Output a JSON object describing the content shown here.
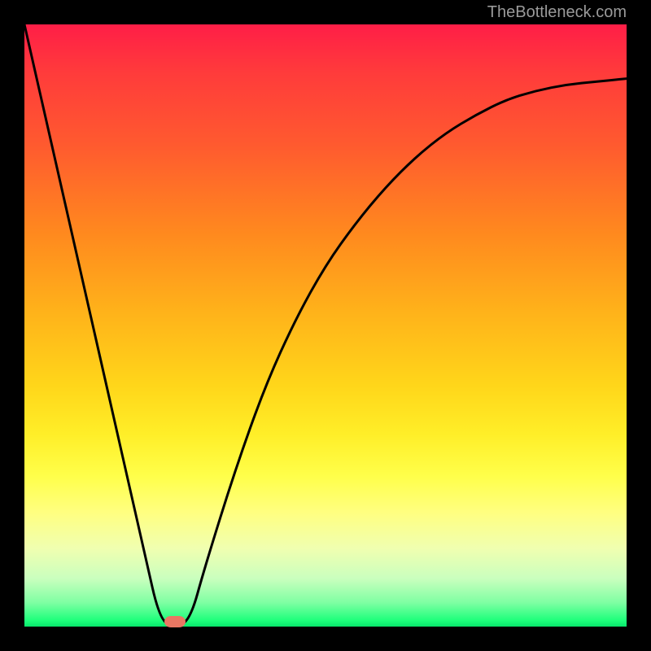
{
  "watermark": "TheBottleneck.com",
  "chart_data": {
    "type": "line",
    "title": "",
    "xlabel": "",
    "ylabel": "",
    "xlim": [
      0,
      100
    ],
    "ylim": [
      0,
      100
    ],
    "grid": false,
    "series": [
      {
        "name": "curve",
        "x": [
          0,
          5,
          10,
          15,
          20,
          22.5,
          25,
          27.5,
          30,
          35,
          40,
          45,
          50,
          55,
          60,
          65,
          70,
          75,
          80,
          85,
          90,
          95,
          100
        ],
        "y": [
          100,
          78,
          56,
          34,
          12,
          1,
          0,
          1,
          10,
          26,
          40,
          51,
          60,
          67,
          73,
          78,
          82,
          85,
          87.5,
          89,
          90,
          90.5,
          91
        ]
      }
    ],
    "marker": {
      "x": 25,
      "y": 0.8
    },
    "gradient_stops": [
      {
        "pct": 0,
        "color": "#ff1e47"
      },
      {
        "pct": 50,
        "color": "#ffd61a"
      },
      {
        "pct": 75,
        "color": "#ffff4a"
      },
      {
        "pct": 100,
        "color": "#08e76c"
      }
    ]
  }
}
